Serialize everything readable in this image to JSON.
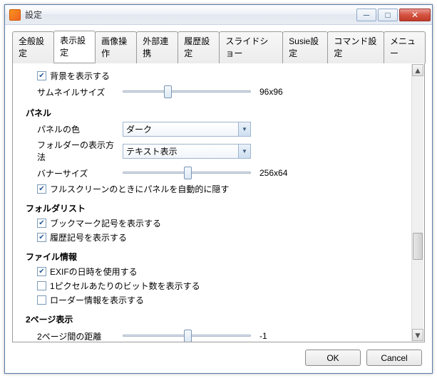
{
  "window": {
    "title": "設定"
  },
  "tabs": [
    "全般設定",
    "表示設定",
    "画像操作",
    "外部連携",
    "履歴設定",
    "スライドショー",
    "Susie設定",
    "コマンド設定",
    "メニュー"
  ],
  "active_tab": 1,
  "top": {
    "show_bg": {
      "checked": true,
      "label": "背景を表示する"
    },
    "thumb_label": "サムネイルサイズ",
    "thumb_value": "96x96"
  },
  "panel": {
    "heading": "パネル",
    "color_label": "パネルの色",
    "color_value": "ダーク",
    "folder_disp_label": "フォルダーの表示方法",
    "folder_disp_value": "テキスト表示",
    "banner_label": "バナーサイズ",
    "banner_value": "256x64",
    "fullscreen_hide": {
      "checked": true,
      "label": "フルスクリーンのときにパネルを自動的に隠す"
    }
  },
  "folderlist": {
    "heading": "フォルダリスト",
    "bookmark": {
      "checked": true,
      "label": "ブックマーク記号を表示する"
    },
    "history": {
      "checked": true,
      "label": "履歴記号を表示する"
    }
  },
  "fileinfo": {
    "heading": "ファイル情報",
    "exif": {
      "checked": true,
      "label": "EXIFの日時を使用する"
    },
    "bpp": {
      "checked": false,
      "label": "1ピクセルあたりのビット数を表示する"
    },
    "loader": {
      "checked": false,
      "label": "ローダー情報を表示する"
    }
  },
  "twopage": {
    "heading": "2ページ表示",
    "gap_label": "2ページ間の距離",
    "gap_value": "-1"
  },
  "buttons": {
    "ok": "OK",
    "cancel": "Cancel"
  }
}
